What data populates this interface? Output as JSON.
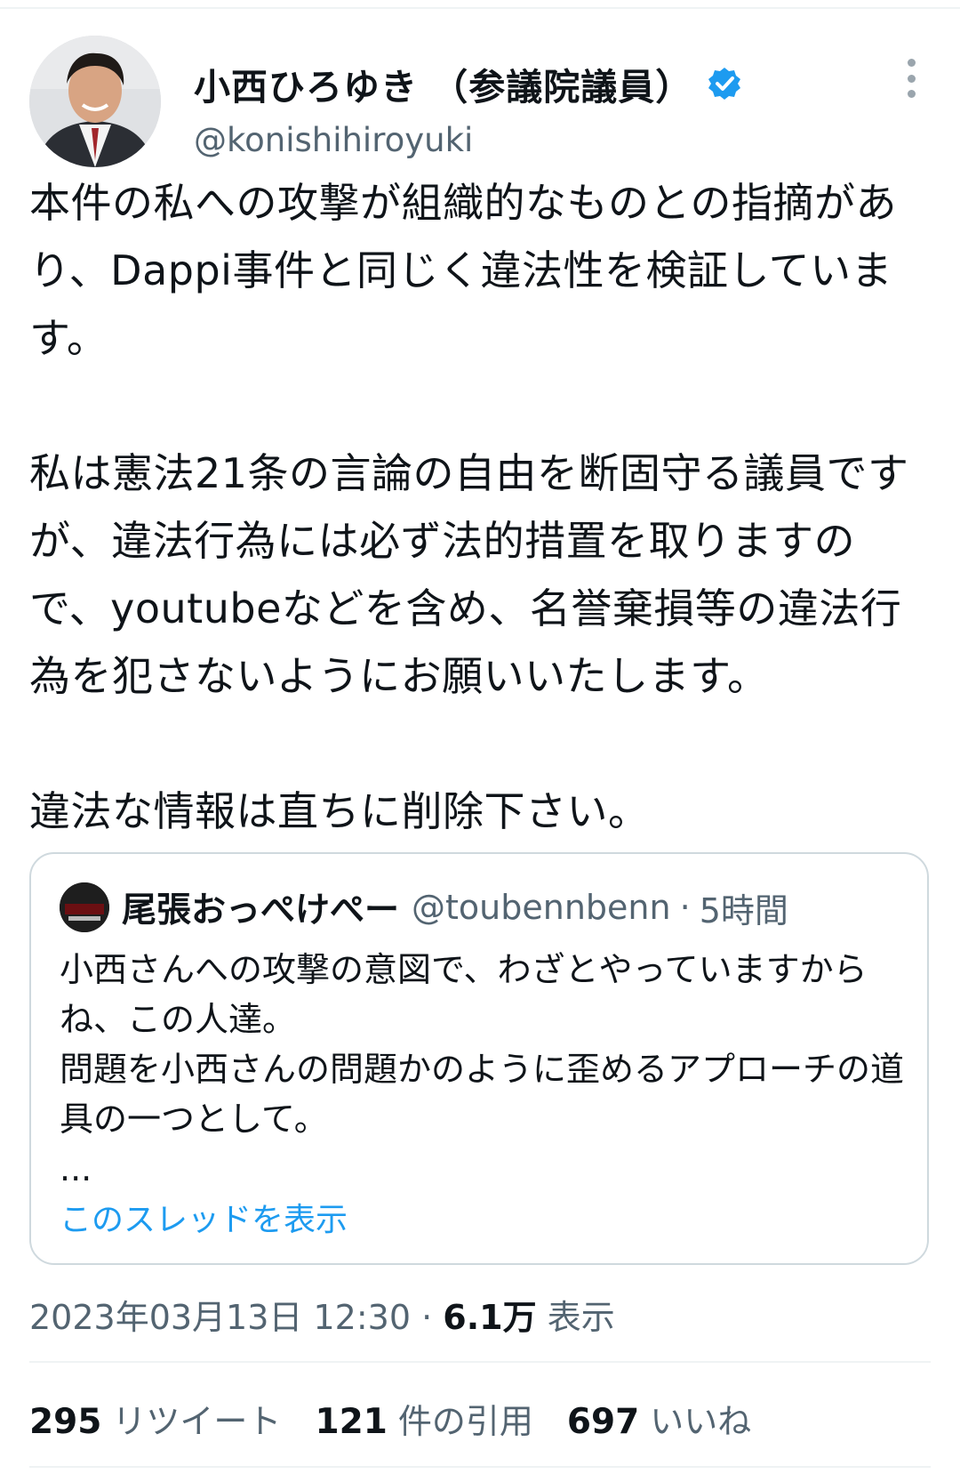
{
  "tweet": {
    "display_name": "小西ひろゆき （参議院議員）",
    "handle": "@konishihiroyuki",
    "avatar_icon": "profile-photo",
    "verified_icon": "verified-badge-icon",
    "more_icon": "more-vertical-icon",
    "text": "本件の私への攻撃が組織的なものとの指摘があり、Dappi事件と同じく違法性を検証しています。\n\n私は憲法21条の言論の自由を断固守る議員ですが、違法行為には必ず法的措置を取りますので、youtubeなどを含め、名誉棄損等の違法行為を犯さないようにお願いいたします。\n\n違法な情報は直ちに削除下さい。"
  },
  "quote": {
    "display_name": "尾張おっぺけぺー",
    "handle": "@toubennbenn",
    "separator": "·",
    "time": "5時間",
    "text": "小西さんへの攻撃の意図で、わざとやっていますからね、この人達。\n問題を小西さんの問題かのように歪めるアプローチの道具の一つとして。\n...",
    "show_thread": "このスレッドを表示"
  },
  "meta": {
    "timestamp": "2023年03月13日 12:30",
    "separator": "·",
    "views_count": "6.1万",
    "views_label": "表示"
  },
  "stats": {
    "retweets_count": "295",
    "retweets_label": "リツイート",
    "quotes_count": "121",
    "quotes_label": "件の引用",
    "likes_count": "697",
    "likes_label": "いいね"
  },
  "colors": {
    "accent": "#1d9bf0",
    "text": "#0f1419",
    "secondary": "#536471",
    "border": "#cfd9de"
  }
}
